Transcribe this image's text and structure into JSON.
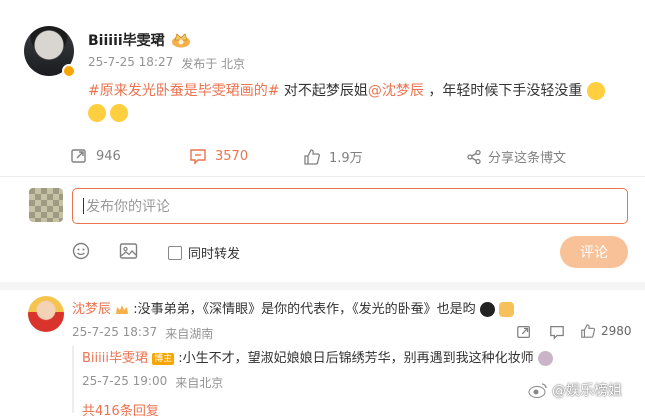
{
  "post": {
    "author": "Biiiii毕雯珺",
    "time": "25-7-25 18:27",
    "source": "发布于 北京",
    "topic1": "#原来发光卧蚕是毕雯珺画的#",
    "text1": " 对不起梦辰姐",
    "mention": "@沈梦辰",
    "text2": " ，年轻时候下手没轻没重",
    "actions": {
      "share": "946",
      "comment": "3570",
      "like": "1.9万",
      "share_post": "分享这条博文"
    }
  },
  "composer": {
    "placeholder": "发布你的评论",
    "repost_label": "同时转发",
    "submit_label": "评论"
  },
  "comment": {
    "author": "沈梦辰",
    "text": ":没事弟弟，《深情眼》是你的代表作，《发光的卧蚕》也是昀",
    "time": "25-7-25 18:37",
    "source": "来自湖南",
    "likes": "2980",
    "reply": {
      "author": "Biiiii毕雯珺",
      "badge": "博主",
      "text": ":小生不才，望淑妃娘娘日后锦绣芳华，别再遇到我这种化妆师",
      "time": "25-7-25 19:00",
      "source": "来自北京"
    },
    "more_replies": "共416条回复"
  },
  "watermark": "@娱乐榜姐",
  "colors": {
    "accent": "#eb7350",
    "vip": "#f7a500",
    "muted": "#939393"
  },
  "icons": [
    "crown-badge-icon",
    "verified-icon",
    "repost-icon",
    "comment-icon",
    "like-icon",
    "share-icon",
    "emoji-icon",
    "image-icon",
    "checkbox-icon",
    "weibo-logo-icon"
  ]
}
